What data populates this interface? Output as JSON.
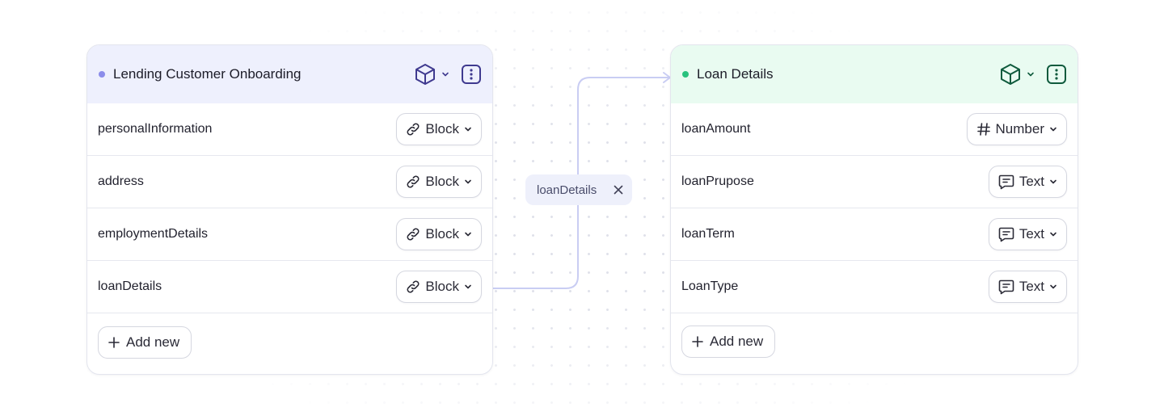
{
  "nodes": {
    "left": {
      "title": "Lending Customer Onboarding",
      "fields": [
        {
          "name": "personalInformation",
          "type": "Block"
        },
        {
          "name": "address",
          "type": "Block"
        },
        {
          "name": "employmentDetails",
          "type": "Block"
        },
        {
          "name": "loanDetails",
          "type": "Block"
        }
      ],
      "add_label": "Add new",
      "accent": "#8b8cea"
    },
    "right": {
      "title": "Loan Details",
      "fields": [
        {
          "name": "loanAmount",
          "type": "Number"
        },
        {
          "name": "loanPrupose",
          "type": "Text"
        },
        {
          "name": "loanTerm",
          "type": "Text"
        },
        {
          "name": "LoanType",
          "type": "Text"
        }
      ],
      "add_label": "Add new",
      "accent": "#29c27e"
    }
  },
  "edge": {
    "label": "loanDetails",
    "color": "#c9cdf3"
  },
  "icons": {
    "header": [
      "cube-icon",
      "chevron-down-icon",
      "kebab-menu-icon"
    ],
    "block_type": "link-icon",
    "number_type": "hash-icon",
    "text_type": "chat-text-icon",
    "add": "plus-icon",
    "remove_edge": "close-icon"
  }
}
